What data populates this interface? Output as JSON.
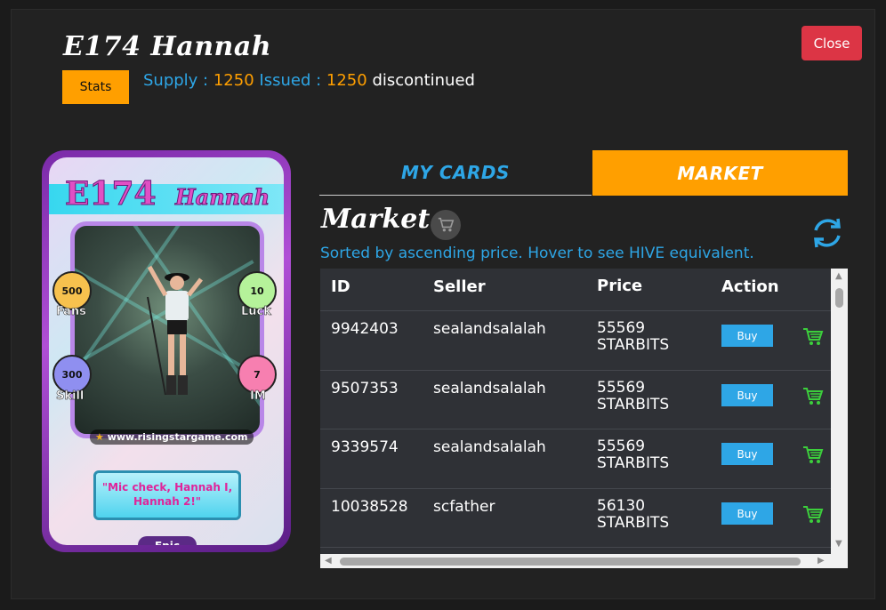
{
  "header": {
    "title": "E174 Hannah",
    "close_label": "Close",
    "stats_label": "Stats",
    "supply_label": "Supply :",
    "supply_value": "1250",
    "issued_label": "Issued :",
    "issued_value": "1250",
    "status": "discontinued"
  },
  "card": {
    "code": "E174",
    "name": "Hannah",
    "stats": [
      {
        "label": "Fans",
        "value": "500",
        "color": "#f7c14e"
      },
      {
        "label": "Luck",
        "value": "10",
        "color": "#b5f29a"
      },
      {
        "label": "Skill",
        "value": "300",
        "color": "#8f8ff0"
      },
      {
        "label": "IM",
        "value": "7",
        "color": "#f77fb0"
      }
    ],
    "site": "www.risingstargame.com",
    "quote": "\"Mic check, Hannah I, Hannah 2!\"",
    "rarity": "Epic"
  },
  "tabs": {
    "my_cards": "MY CARDS",
    "market": "MARKET"
  },
  "market": {
    "title": "Market",
    "sorted_text": "Sorted by ascending price. Hover to see HIVE equivalent.",
    "columns": {
      "id": "ID",
      "seller": "Seller",
      "price": "Price",
      "action": "Action"
    },
    "buy_label": "Buy",
    "rows": [
      {
        "id": "9942403",
        "seller": "sealandsalalah",
        "price": "55569",
        "currency": "STARBITS"
      },
      {
        "id": "9507353",
        "seller": "sealandsalalah",
        "price": "55569",
        "currency": "STARBITS"
      },
      {
        "id": "9339574",
        "seller": "sealandsalalah",
        "price": "55569",
        "currency": "STARBITS"
      },
      {
        "id": "10038528",
        "seller": "scfather",
        "price": "56130",
        "currency": "STARBITS"
      }
    ]
  },
  "colors": {
    "accent_blue": "#2ea6e6",
    "accent_orange": "#ff9f00",
    "close_red": "#dc3545",
    "cart_green": "#3ccf3c"
  }
}
